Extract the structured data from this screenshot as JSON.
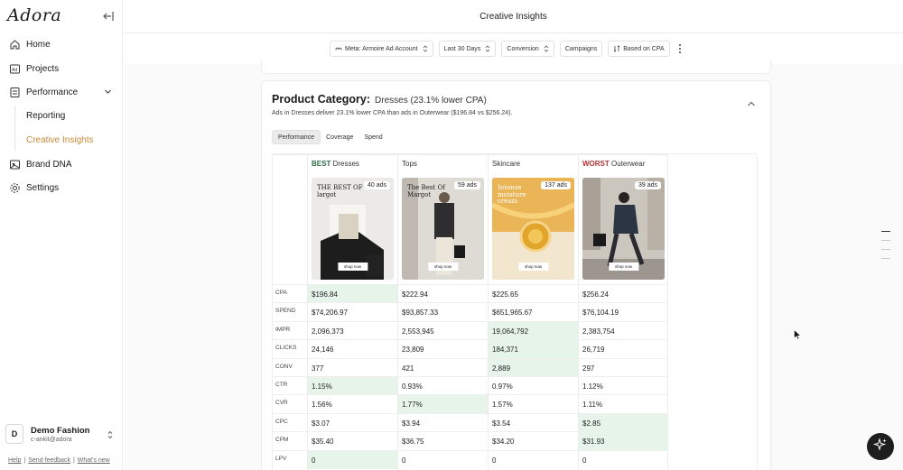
{
  "sidebar": {
    "logo": "Adora",
    "items": [
      {
        "label": "Home",
        "icon": "home-icon"
      },
      {
        "label": "Projects",
        "icon": "projects-icon"
      },
      {
        "label": "Performance",
        "icon": "performance-icon"
      },
      {
        "label": "Brand DNA",
        "icon": "brand-dna-icon"
      },
      {
        "label": "Settings",
        "icon": "gear-icon"
      }
    ],
    "sub_items": [
      {
        "label": "Reporting",
        "active": false
      },
      {
        "label": "Creative Insights",
        "active": true
      }
    ],
    "account": {
      "initial": "D",
      "name": "Demo Fashion",
      "email": "c-ankit@adora"
    },
    "footer": {
      "help": "Help",
      "feedback": "Send feedback",
      "whats_new": "What's new"
    }
  },
  "header": {
    "title": "Creative Insights"
  },
  "filters": {
    "account": "Meta: Armoire Ad Account",
    "range": "Last 30 Days",
    "objective": "Conversion",
    "campaigns": "Campaigns",
    "sort": "Based on CPA"
  },
  "card": {
    "title": "Product Category:",
    "title_value": "Dresses (23.1% lower CPA)",
    "subtitle": "Ads in Dresses deliver 23.1% lower CPA than ads in Outerwear ($196.84 vs $256.24).",
    "tabs": [
      "Performance",
      "Coverage",
      "Spend"
    ],
    "active_tab": "Performance"
  },
  "columns": [
    {
      "tag": "BEST",
      "name": "Dresses",
      "ads": "40 ads",
      "thumb_caption": "THE BEST OF\nlargot",
      "thumb_bg": "#e9e6e2"
    },
    {
      "tag": "",
      "name": "Tops",
      "ads": "59 ads",
      "thumb_caption": "The Best Of\nMargot",
      "thumb_bg": "#dcd8d2"
    },
    {
      "tag": "",
      "name": "Skincare",
      "ads": "137 ads",
      "thumb_caption": "Intense\nmoisture\ncream",
      "thumb_bg": "#e8b350"
    },
    {
      "tag": "WORST",
      "name": "Outerwear",
      "ads": "39 ads",
      "thumb_caption": "",
      "thumb_bg": "#c9c3bb"
    }
  ],
  "shop_label": "shop now",
  "metrics": [
    {
      "label": "CPA",
      "values": [
        "$196.84",
        "$222.94",
        "$225.65",
        "$256.24"
      ],
      "highlight": 0
    },
    {
      "label": "SPEND",
      "values": [
        "$74,206.97",
        "$93,857.33",
        "$651,965.67",
        "$76,104.19"
      ],
      "highlight": -1
    },
    {
      "label": "IMPR",
      "values": [
        "2,096,373",
        "2,553,945",
        "19,064,792",
        "2,383,754"
      ],
      "highlight": 2
    },
    {
      "label": "CLICKS",
      "values": [
        "24,146",
        "23,809",
        "184,371",
        "26,719"
      ],
      "highlight": 2
    },
    {
      "label": "CONV",
      "values": [
        "377",
        "421",
        "2,889",
        "297"
      ],
      "highlight": 2
    },
    {
      "label": "CTR",
      "values": [
        "1.15%",
        "0.93%",
        "0.97%",
        "1.12%"
      ],
      "highlight": 0
    },
    {
      "label": "CVR",
      "values": [
        "1.56%",
        "1.77%",
        "1.57%",
        "1.11%"
      ],
      "highlight": 1
    },
    {
      "label": "CPC",
      "values": [
        "$3.07",
        "$3.94",
        "$3.54",
        "$2.85"
      ],
      "highlight": 3
    },
    {
      "label": "CPM",
      "values": [
        "$35.40",
        "$36.75",
        "$34.20",
        "$31.93"
      ],
      "highlight": 3
    },
    {
      "label": "LPV",
      "values": [
        "0",
        "0",
        "0",
        "0"
      ],
      "highlight": 0
    }
  ],
  "colors": {
    "accent": "#c98a3a",
    "best": "#2f6b47",
    "worst": "#b33434",
    "highlight": "#e6f4ea"
  }
}
